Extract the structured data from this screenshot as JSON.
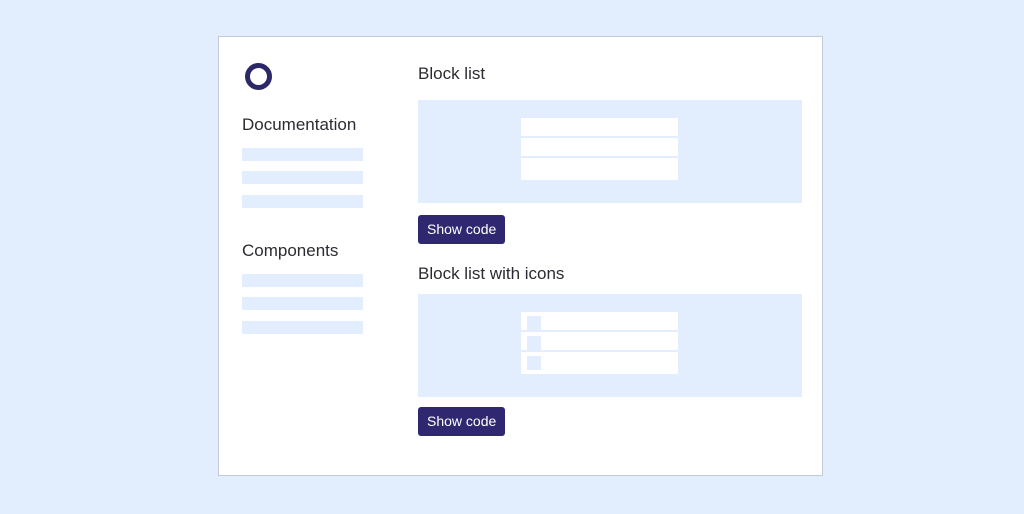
{
  "sidebar": {
    "logo_icon": "circle-logo-icon",
    "sections": [
      {
        "heading": "Documentation",
        "placeholder_items": 3
      },
      {
        "heading": "Components",
        "placeholder_items": 3
      }
    ]
  },
  "main": {
    "examples": [
      {
        "title": "Block list",
        "rows": 3,
        "with_icons": false,
        "button_label": "Show code"
      },
      {
        "title": "Block list with icons",
        "rows": 3,
        "with_icons": true,
        "button_label": "Show code"
      }
    ]
  },
  "colors": {
    "background": "#e2edfe",
    "accent": "#2f2870",
    "logo": "#2a2868",
    "text": "#2b2b33",
    "border": "#c3cbdb"
  }
}
